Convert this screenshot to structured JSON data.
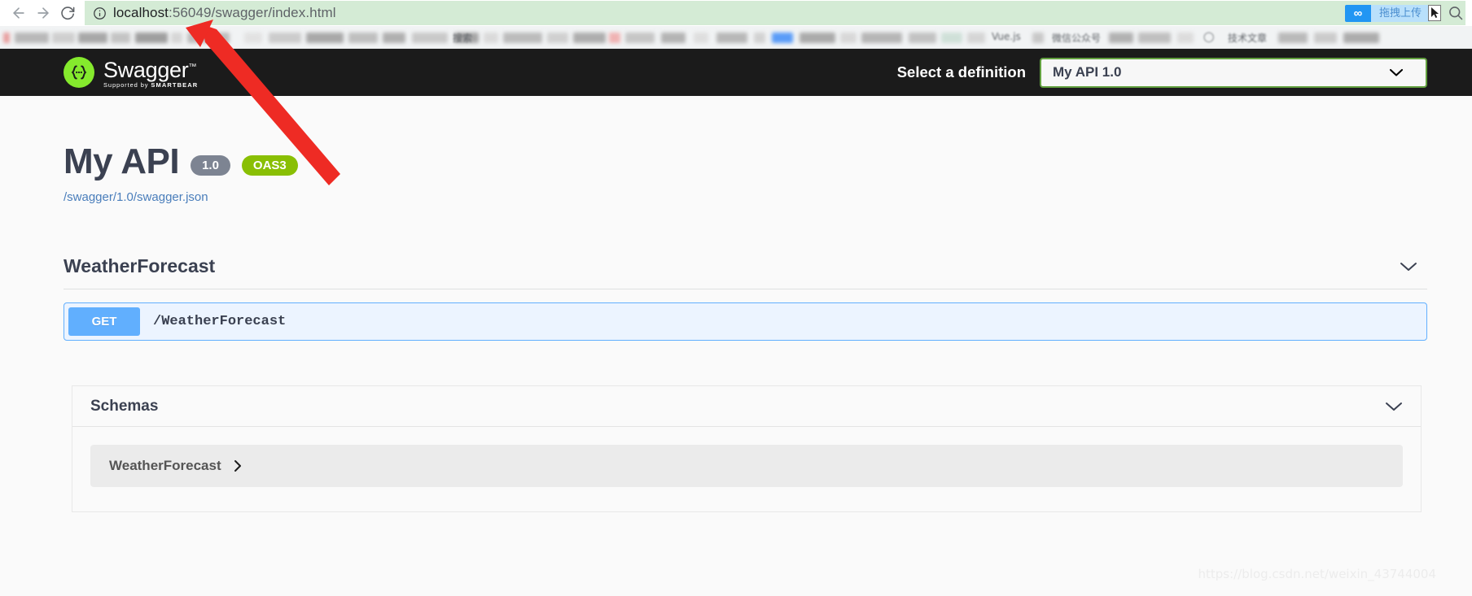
{
  "browser": {
    "url_host": "localhost",
    "url_rest": ":56049/swagger/index.html",
    "url_full": "localhost:56049/swagger/index.html",
    "site_info_icon": "info-circle-icon",
    "back_icon": "arrow-left-icon",
    "forward_icon": "arrow-right-icon",
    "reload_icon": "reload-icon",
    "extension": {
      "icon": "infinity-icon",
      "label": "拖拽上传"
    },
    "omnibox_search_icon": "magnifier-icon",
    "bookmark_bar": {
      "visible_fragments": [
        "Vue.js",
        "微信公众号",
        "技术文章"
      ]
    }
  },
  "topbar": {
    "logo_text": "Swagger",
    "logo_trademark": "™",
    "tagline_prefix": "Supported by",
    "tagline_brand": "SMARTBEAR",
    "logo_mark_glyph": "{···}",
    "select_definition_label": "Select a definition",
    "definition_selected": "My API 1.0",
    "definition_options": [
      "My API 1.0"
    ],
    "chevron_icon": "chevron-down-icon"
  },
  "info": {
    "title": "My API",
    "version_badge": "1.0",
    "oas_badge": "OAS3",
    "spec_url": "/swagger/1.0/swagger.json"
  },
  "tag_section": {
    "name": "WeatherForecast",
    "collapse_icon": "chevron-down-icon",
    "operations": [
      {
        "method": "GET",
        "path": "/WeatherForecast",
        "summary": ""
      }
    ]
  },
  "schemas": {
    "title": "Schemas",
    "collapse_icon": "chevron-down-icon",
    "items": [
      {
        "name": "WeatherForecast",
        "expand_icon": "chevron-right-icon"
      }
    ]
  },
  "overlay": {
    "watermark": "https://blog.csdn.net/weixin_43744004",
    "arrow_color": "#ee2b24"
  },
  "colors": {
    "topbar_bg": "#1b1b1b",
    "swagger_green": "#85ea2d",
    "oas_green": "#89bf04",
    "version_gray": "#7d8492",
    "get_blue": "#61affe",
    "get_block_bg": "#ecf4ff",
    "text_dark": "#3b4151",
    "url_bar_green": "#d4ebd5",
    "link_blue": "#4a7ebb",
    "select_border_green": "#62a03f"
  }
}
